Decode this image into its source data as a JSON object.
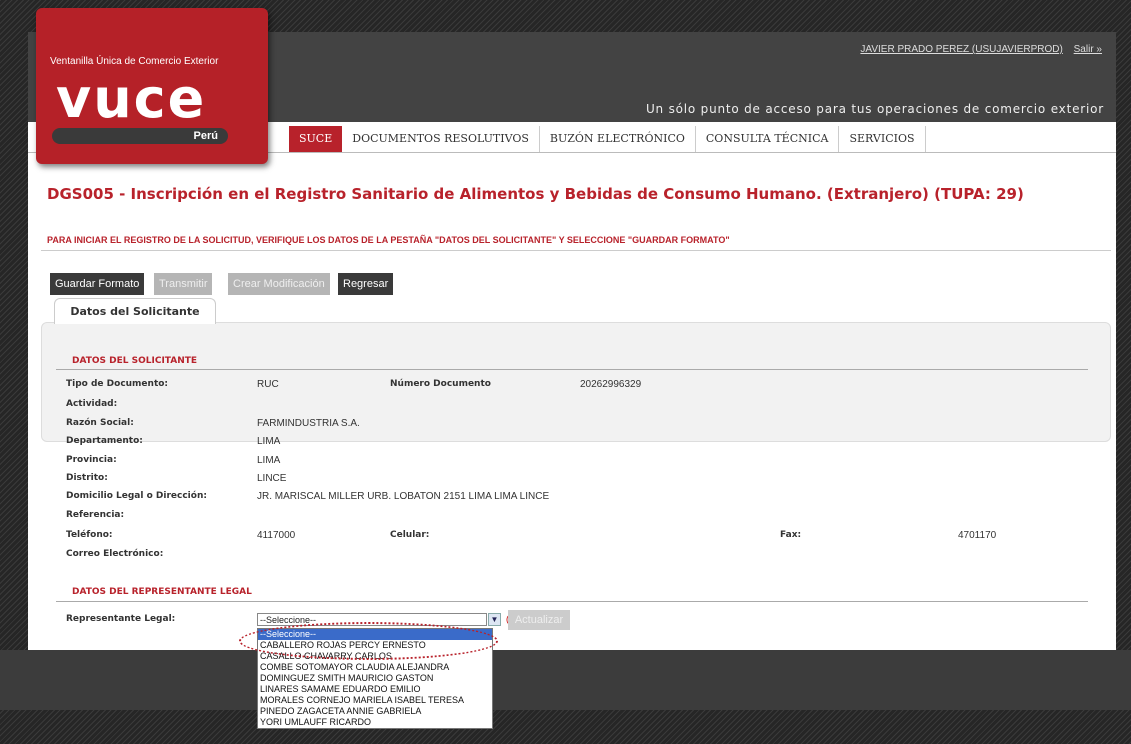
{
  "header": {
    "user_link": "JAVIER PRADO PEREZ (USUJAVIERPROD)",
    "logout_link": "Salir »",
    "tagline": "Un sólo punto de acceso para tus operaciones de comercio exterior"
  },
  "logo": {
    "subtitle": "Ventanilla Única de Comercio Exterior",
    "name": "vuce",
    "country": "Perú"
  },
  "nav": {
    "items": [
      "SUCE",
      "DOCUMENTOS RESOLUTIVOS",
      "BUZÓN ELECTRÓNICO",
      "CONSULTA TÉCNICA",
      "SERVICIOS"
    ],
    "active": "SUCE"
  },
  "page": {
    "title": "DGS005 - Inscripción en el Registro Sanitario de Alimentos y Bebidas de Consumo Humano. (Extranjero) (TUPA: 29)",
    "instruction": "PARA INICIAR EL REGISTRO DE LA SOLICITUD, VERIFIQUE LOS DATOS DE LA PESTAÑA \"DATOS DEL SOLICITANTE\" Y SELECCIONE \"GUARDAR FORMATO\""
  },
  "toolbar": {
    "guardar": "Guardar Formato",
    "transmitir": "Transmitir",
    "crear": "Crear Modificación",
    "regresar": "Regresar"
  },
  "tab": {
    "label": "Datos del Solicitante"
  },
  "solicitante": {
    "section": "DATOS DEL SOLICITANTE",
    "tipo_doc_label": "Tipo de Documento:",
    "tipo_doc": "RUC",
    "num_doc_label": "Número Documento",
    "num_doc": "20262996329",
    "actividad_label": "Actividad:",
    "razon_label": "Razón Social:",
    "razon": "FARMINDUSTRIA S.A.",
    "depto_label": "Departamento:",
    "depto": "LIMA",
    "prov_label": "Provincia:",
    "prov": "LIMA",
    "distrito_label": "Distrito:",
    "distrito": "LINCE",
    "domicilio_label": "Domicilio Legal o Dirección:",
    "domicilio": "JR. MARISCAL MILLER URB. LOBATON 2151 LIMA LIMA LINCE",
    "referencia_label": "Referencia:",
    "telefono_label": "Teléfono:",
    "telefono": "4117000",
    "celular_label": "Celular:",
    "fax_label": "Fax:",
    "fax": "4701170",
    "correo_label": "Correo Electrónico:"
  },
  "representante": {
    "section": "DATOS DEL REPRESENTANTE LEGAL",
    "label": "Representante Legal:",
    "selected": "--Seleccione--",
    "required": "(*)",
    "actualizar": "Actualizar",
    "options": [
      "--Seleccione--",
      "CABALLERO ROJAS PERCY ERNESTO",
      "CASALLO CHAVARRY CARLOS",
      "COMBE SOTOMAYOR CLAUDIA ALEJANDRA",
      "DOMINGUEZ SMITH MAURICIO GASTON",
      "LINARES SAMAME EDUARDO EMILIO",
      "MORALES CORNEJO MARIELA ISABEL TERESA",
      "PINEDO ZAGACETA ANNIE GABRIELA",
      "YORI UMLAUFF RICARDO"
    ]
  }
}
